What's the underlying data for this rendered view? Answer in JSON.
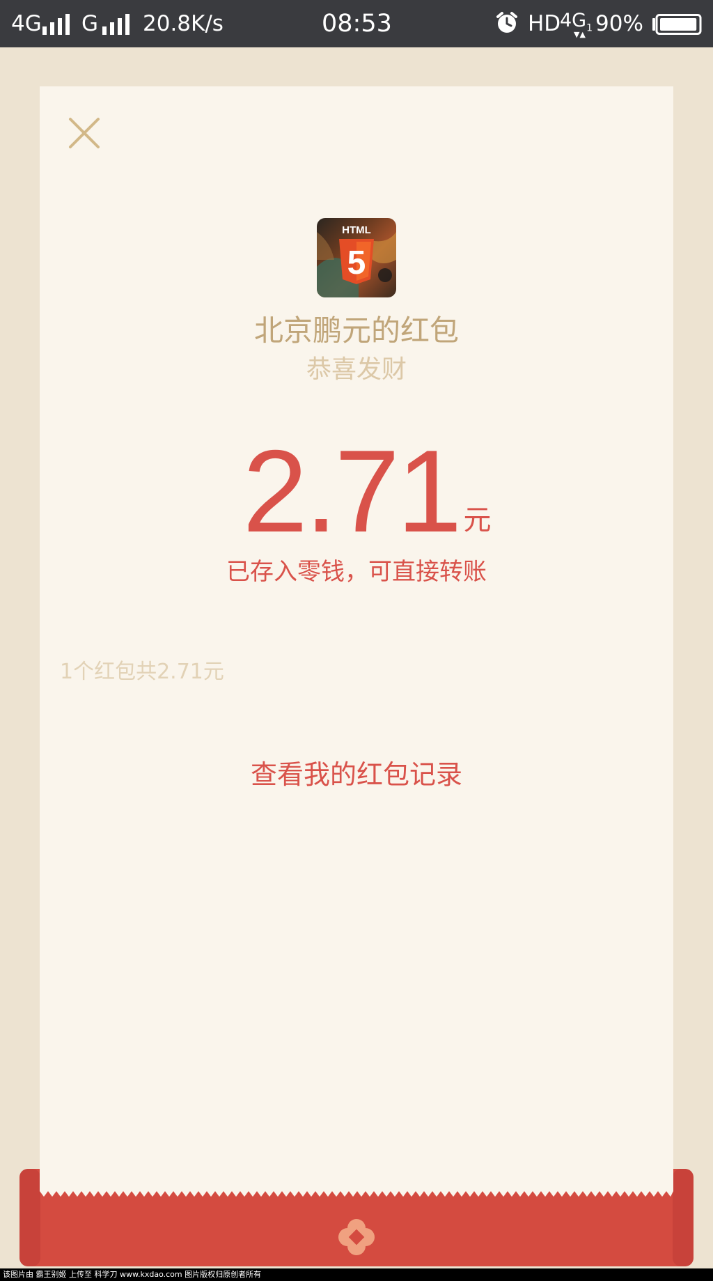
{
  "status_bar": {
    "network_1": "4G",
    "network_2": "G",
    "speed": "20.8K/s",
    "time": "08:53",
    "hd": "HD",
    "network_right": "4G",
    "network_right_sub": "1",
    "battery_percent": "90%",
    "battery_level": 0.9,
    "icons": [
      "signal-icon",
      "signal-icon",
      "alarm-clock-icon",
      "battery-icon"
    ]
  },
  "card": {
    "close_icon": "close-icon",
    "avatar_icon": "html5-avatar-icon",
    "avatar_text": "HTML",
    "avatar_digit": "5",
    "sender_title": "北京鹏元的红包",
    "blessing": "恭喜发财",
    "amount": "2.71",
    "amount_unit": "元",
    "deposit_note": "已存入零钱，可直接转账",
    "summary": "1个红包共2.71元",
    "record_link": "查看我的红包记录"
  },
  "envelope": {
    "emblem_icon": "red-envelope-emblem-icon"
  },
  "watermark": {
    "text": "该图片由 霸王别姬 上传至 科学刀 www.kxdao.com 图片版权归原创者所有"
  },
  "colors": {
    "status_bar_bg": "#3a3b3f",
    "page_bg": "#ede3d1",
    "card_bg": "#faf5ec",
    "accent_red": "#d9524a",
    "gold": "#c0a579",
    "light_gold": "#dcc8a7"
  }
}
